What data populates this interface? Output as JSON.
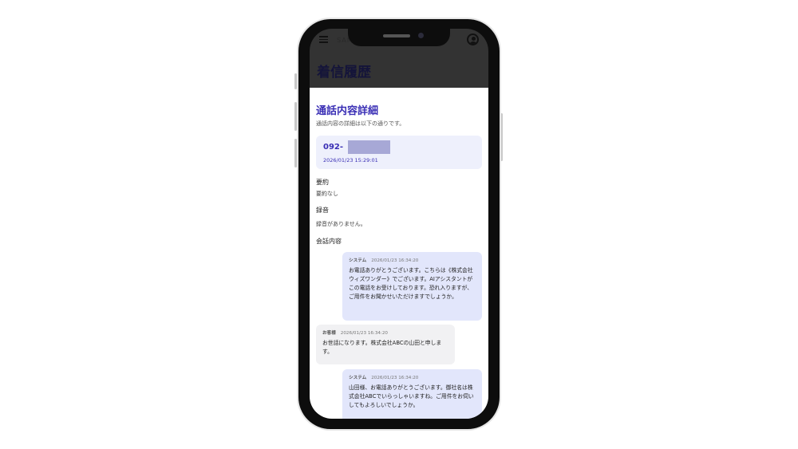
{
  "app": {
    "logo_text": "SAMURAI",
    "page_title": "着信履歴"
  },
  "modal": {
    "title": "通話内容詳細",
    "subtitle": "通話内容の詳細は以下の通りです。",
    "phone_number_prefix": "092-",
    "call_datetime": "2026/01/23 15:29:01",
    "summary_label": "要約",
    "summary_value": "要約なし",
    "recording_label": "録音",
    "recording_value": "録音がありません。",
    "conversation_label": "会話内容"
  },
  "messages": [
    {
      "speaker": "システム",
      "time": "2026/01/23 16:34:20",
      "text": "お電話ありがとうございます。こちらは《株式会社ウィズワンダー》でございます。AIアシスタントがこの電話をお受けしております。恐れ入りますが、ご用件をお聞かせいただけますでしょうか。"
    },
    {
      "speaker": "お客様",
      "time": "2026/01/23 16:34:20",
      "text": "お世話になります。株式会社ABCの山田と申します。"
    },
    {
      "speaker": "システム",
      "time": "2026/01/23 16:34:20",
      "text": "山田様、お電話ありがとうございます。御社名は株式会社ABCでいらっしゃいますね。ご用件をお伺いしてもよろしいでしょうか。"
    }
  ],
  "colors": {
    "accent": "#3a2fb5",
    "system_bubble": "#e2e6fb",
    "customer_bubble": "#f1f1f3",
    "header_bg": "#333333"
  },
  "icons": {
    "menu": "hamburger-menu-icon",
    "account": "user-account-icon"
  }
}
